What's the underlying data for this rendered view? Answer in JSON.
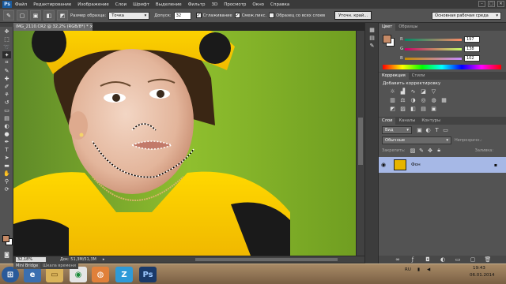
{
  "menubar": {
    "logo": "Ps",
    "items": [
      "Файл",
      "Редактирование",
      "Изображение",
      "Слои",
      "Шрифт",
      "Выделение",
      "Фильтр",
      "3D",
      "Просмотр",
      "Окно",
      "Справка"
    ]
  },
  "options": {
    "sample_size_label": "Размер образца:",
    "sample_size_value": "Точка",
    "tolerance_label": "Допуск:",
    "tolerance_value": "32",
    "antialias_label": "Сглаживание",
    "contiguous_label": "Смеж.пикс.",
    "sample_all_label": "Образец со всех слоев",
    "refine_button": "Уточн. край...",
    "workspace_value": "Основная рабочая среда"
  },
  "document": {
    "tab_title": "IMG_2110.CR2 @ 32,2% (RGB/8*) *",
    "zoom": "32,18%",
    "doc_size": "Док: 51,3M/51,3M"
  },
  "color_panel": {
    "tabs": [
      "Цвет",
      "Образцы"
    ],
    "r_label": "R",
    "r_value": "197",
    "g_label": "G",
    "g_value": "138",
    "b_label": "B",
    "b_value": "102",
    "foreground": "#c58a66"
  },
  "adjust_panel": {
    "tabs": [
      "Коррекция",
      "Стили"
    ],
    "title": "Добавить корректировку"
  },
  "layers_panel": {
    "tabs": [
      "Слои",
      "Каналы",
      "Контуры"
    ],
    "kind_label": "Вид",
    "blend_mode": "Обычные",
    "opacity_label": "Непрозрачн.:",
    "lock_label": "Закрепить:",
    "fill_label": "Заливка:",
    "layer_name": "Фон"
  },
  "bottom_tabs": [
    "Mini Bridge",
    "Шкала времени"
  ],
  "taskbar": {
    "lang": "RU",
    "time": "19:43",
    "date": "06.01.2014"
  },
  "colors": {
    "accent": "#1a5a9c",
    "selected_layer": "#a6b8e6"
  }
}
